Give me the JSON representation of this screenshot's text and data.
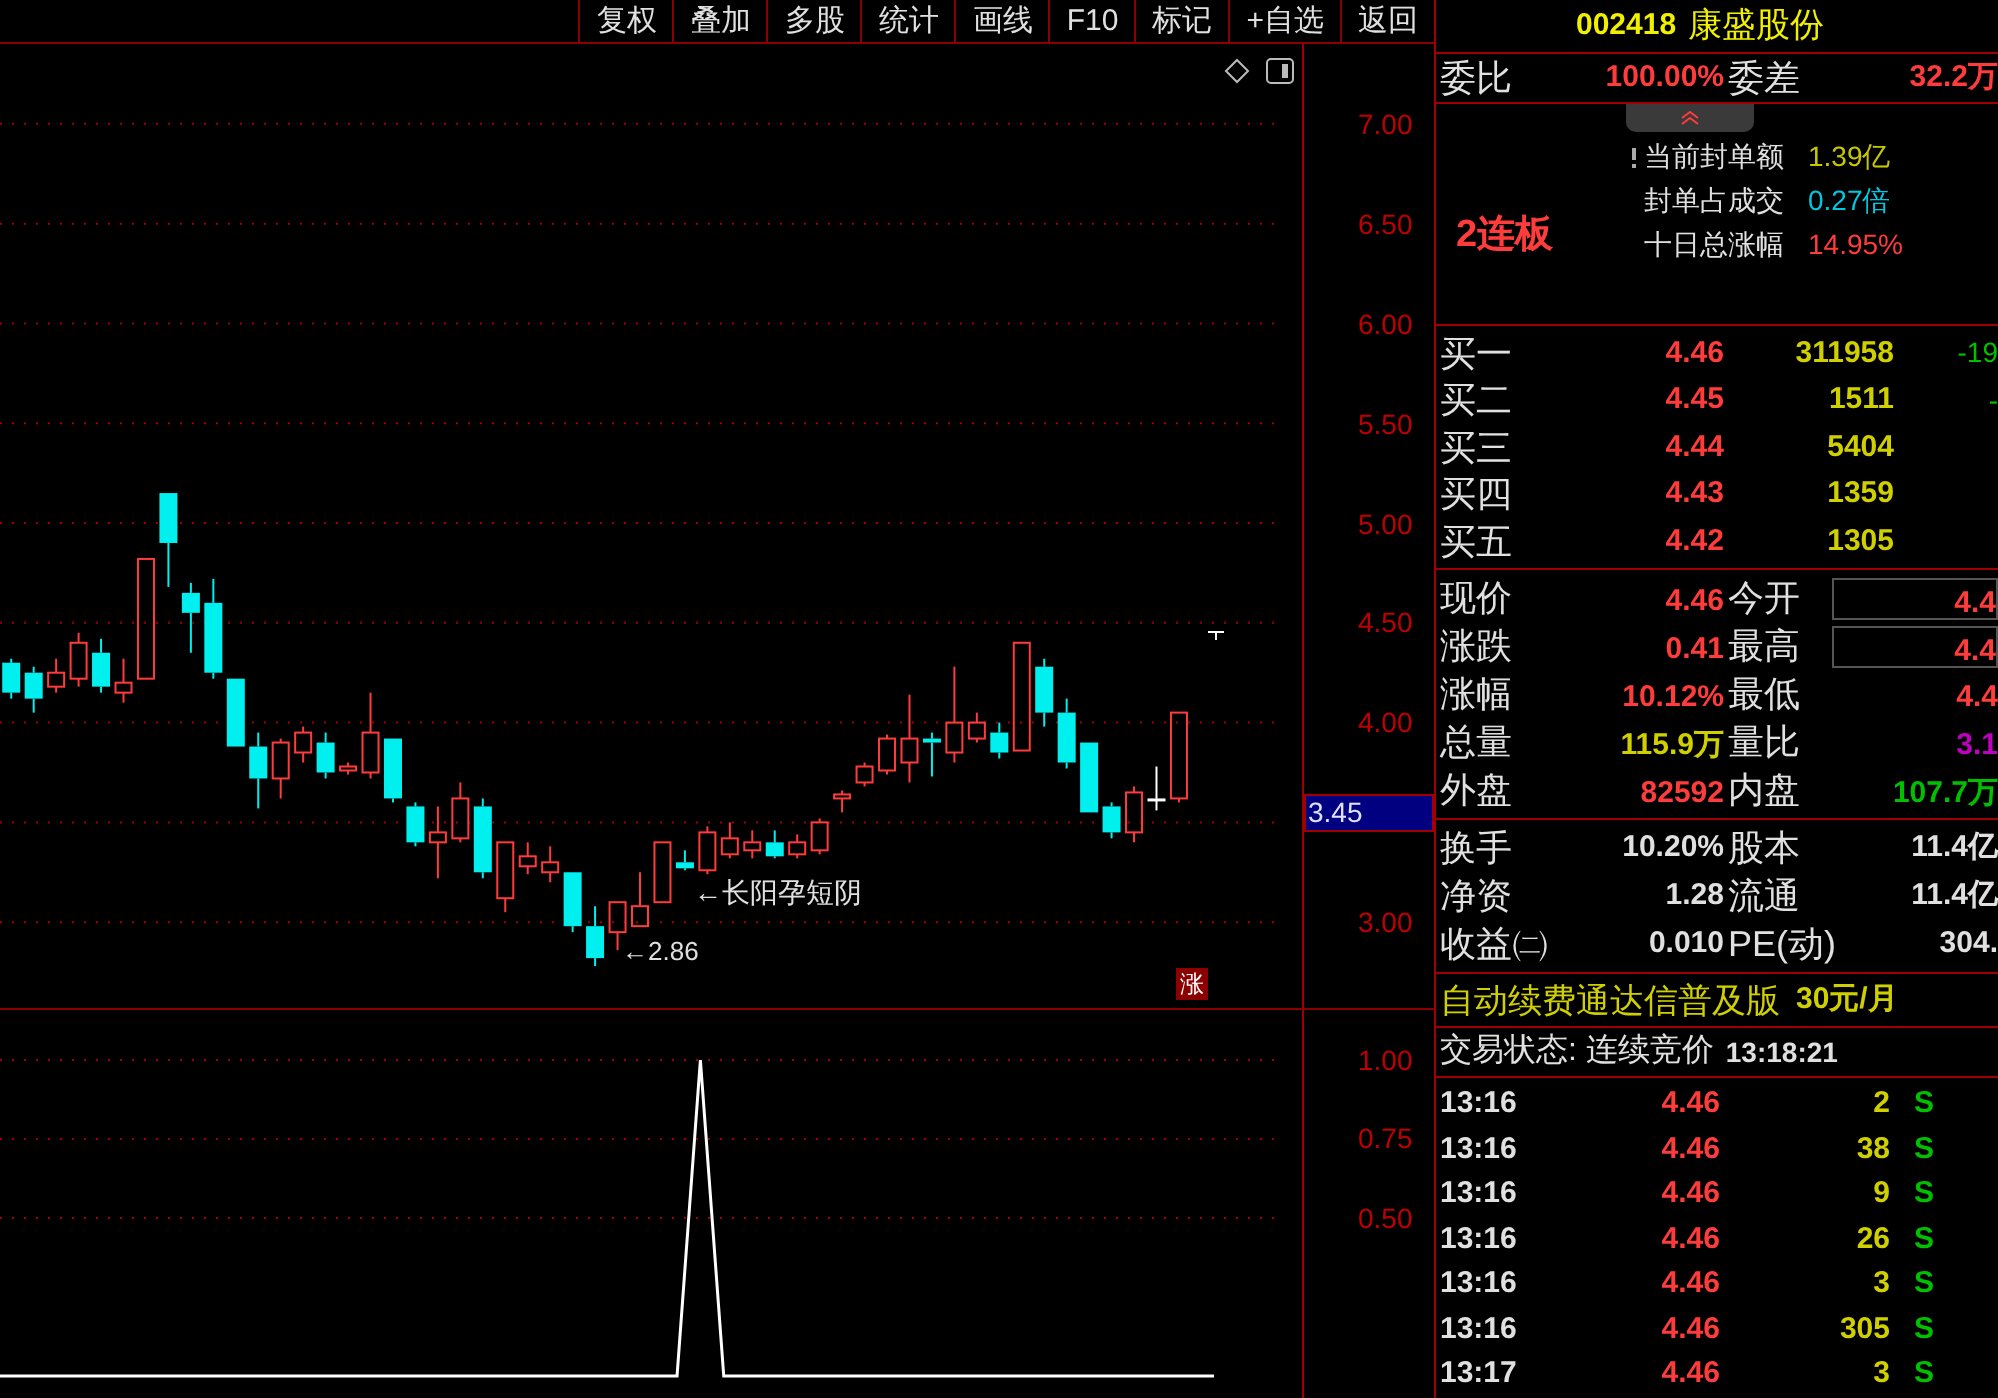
{
  "toolbar": {
    "buttons": [
      {
        "label": "复权"
      },
      {
        "label": "叠加"
      },
      {
        "label": "多股"
      },
      {
        "label": "统计"
      },
      {
        "label": "画线"
      },
      {
        "label": "F10"
      },
      {
        "label": "标记"
      },
      {
        "label": "+自选"
      },
      {
        "label": "返回"
      }
    ]
  },
  "price_chart": {
    "crosshair_price": "3.45",
    "annotations": [
      "←长阳孕短阴",
      "←2.86"
    ],
    "limit_badge": "涨",
    "chart_data": {
      "type": "candlestick",
      "ylim": [
        2.56,
        7.4
      ],
      "grid": true,
      "yticks": [
        {
          "value": 7,
          "label": "7.00"
        },
        {
          "value": 6.5,
          "label": "6.50"
        },
        {
          "value": 6,
          "label": "6.00"
        },
        {
          "value": 5.5,
          "label": "5.50"
        },
        {
          "value": 5,
          "label": "5.00"
        },
        {
          "value": 4.5,
          "label": "4.50"
        },
        {
          "value": 4,
          "label": "4.00"
        },
        {
          "value": 3,
          "label": "3.00"
        }
      ],
      "ohlc": [
        [
          4.3,
          4.32,
          4.12,
          4.15
        ],
        [
          4.25,
          4.28,
          4.05,
          4.12
        ],
        [
          4.18,
          4.32,
          4.15,
          4.25
        ],
        [
          4.22,
          4.45,
          4.18,
          4.4
        ],
        [
          4.35,
          4.42,
          4.15,
          4.18
        ],
        [
          4.15,
          4.32,
          4.1,
          4.2
        ],
        [
          4.22,
          4.82,
          4.22,
          4.82
        ],
        [
          5.15,
          5.15,
          4.68,
          4.9
        ],
        [
          4.65,
          4.7,
          4.35,
          4.55
        ],
        [
          4.6,
          4.72,
          4.22,
          4.25
        ],
        [
          4.22,
          4.22,
          3.88,
          3.88
        ],
        [
          3.88,
          3.95,
          3.57,
          3.72
        ],
        [
          3.72,
          3.92,
          3.62,
          3.9
        ],
        [
          3.85,
          3.98,
          3.8,
          3.95
        ],
        [
          3.9,
          3.95,
          3.72,
          3.75
        ],
        [
          3.76,
          3.8,
          3.74,
          3.78
        ],
        [
          3.75,
          4.15,
          3.72,
          3.95
        ],
        [
          3.92,
          3.92,
          3.6,
          3.62
        ],
        [
          3.58,
          3.6,
          3.38,
          3.4
        ],
        [
          3.4,
          3.58,
          3.22,
          3.45
        ],
        [
          3.42,
          3.7,
          3.4,
          3.62
        ],
        [
          3.58,
          3.62,
          3.22,
          3.25
        ],
        [
          3.12,
          3.4,
          3.05,
          3.4
        ],
        [
          3.28,
          3.4,
          3.24,
          3.33
        ],
        [
          3.25,
          3.38,
          3.2,
          3.3
        ],
        [
          3.25,
          3.25,
          2.95,
          2.98
        ],
        [
          2.98,
          3.08,
          2.78,
          2.82
        ],
        [
          2.95,
          3.1,
          2.86,
          3.1
        ],
        [
          2.98,
          3.25,
          2.98,
          3.08
        ],
        [
          3.1,
          3.4,
          3.1,
          3.4
        ],
        [
          3.3,
          3.36,
          3.26,
          3.27
        ],
        [
          3.26,
          3.48,
          3.24,
          3.45
        ],
        [
          3.34,
          3.5,
          3.32,
          3.42
        ],
        [
          3.36,
          3.46,
          3.32,
          3.4
        ],
        [
          3.4,
          3.46,
          3.32,
          3.33
        ],
        [
          3.34,
          3.44,
          3.32,
          3.4
        ],
        [
          3.36,
          3.52,
          3.34,
          3.5
        ],
        [
          3.62,
          3.66,
          3.55,
          3.64
        ],
        [
          3.7,
          3.8,
          3.68,
          3.78
        ],
        [
          3.76,
          3.94,
          3.74,
          3.92
        ],
        [
          3.8,
          4.14,
          3.7,
          3.92
        ],
        [
          3.92,
          3.95,
          3.73,
          3.9
        ],
        [
          3.85,
          4.28,
          3.8,
          4.0
        ],
        [
          3.92,
          4.05,
          3.9,
          4.0
        ],
        [
          3.95,
          4.0,
          3.82,
          3.85
        ],
        [
          3.86,
          4.4,
          3.86,
          4.4
        ],
        [
          4.28,
          4.32,
          3.98,
          4.05
        ],
        [
          4.05,
          4.12,
          3.77,
          3.8
        ],
        [
          3.9,
          3.9,
          3.55,
          3.55
        ],
        [
          3.58,
          3.6,
          3.42,
          3.45
        ],
        [
          3.45,
          3.68,
          3.4,
          3.65
        ],
        [
          3.62,
          3.78,
          3.56,
          3.62
        ],
        [
          3.62,
          4.05,
          3.6,
          4.05
        ],
        null,
        null,
        null,
        null
      ]
    }
  },
  "indicator": {
    "chart_data": {
      "type": "line",
      "ylim": [
        -0.07,
        1
      ],
      "grid": true,
      "yticks": [
        {
          "value": 1,
          "label": "1.00"
        },
        {
          "value": 0.75,
          "label": "0.75"
        },
        {
          "value": 0.5,
          "label": "0.50"
        }
      ],
      "series": [
        {
          "color": "#ffffff",
          "values": [
            0,
            0,
            0,
            0,
            0,
            0,
            0,
            0,
            0,
            0,
            0,
            0,
            0,
            0,
            0,
            0,
            0,
            0,
            0,
            0,
            0,
            0,
            0,
            0,
            0,
            0,
            0,
            0,
            0,
            0,
            1,
            0,
            0,
            0,
            0,
            0,
            0,
            0,
            0,
            0,
            0,
            0,
            0,
            0,
            0,
            0,
            0,
            0,
            0,
            0,
            0,
            0,
            0
          ]
        }
      ]
    }
  },
  "quote": {
    "code": "002418",
    "name": "康盛股份"
  },
  "order_ratio": [
    {
      "label": "委比",
      "value": "100.00%"
    },
    {
      "label": "委差",
      "value": "32.2万"
    }
  ],
  "seal": {
    "streak": "2连板",
    "items": [
      {
        "label": "当前封单额",
        "value": "1.39亿",
        "color": "#c8c800"
      },
      {
        "label": "封单占成交",
        "value": "0.27倍",
        "color": "#00c8e0"
      },
      {
        "label": "十日总涨幅",
        "value": "14.95%",
        "color": "#ff3c3c"
      }
    ]
  },
  "bids": [
    {
      "label": "买一",
      "price": "4.46",
      "volume": "311958",
      "change": "-19"
    },
    {
      "label": "买二",
      "price": "4.45",
      "volume": "1511",
      "change": "-"
    },
    {
      "label": "买三",
      "price": "4.44",
      "volume": "5404"
    },
    {
      "label": "买四",
      "price": "4.43",
      "volume": "1359"
    },
    {
      "label": "买五",
      "price": "4.42",
      "volume": "1305"
    }
  ],
  "stats": [
    {
      "label": "现价",
      "value": "4.46",
      "color": "#ff3c3c",
      "boxed": false
    },
    {
      "label": "今开",
      "value": "4.4",
      "color": "#ff3c3c",
      "boxed": true
    },
    {
      "label": "涨跌",
      "value": "0.41",
      "color": "#ff3c3c",
      "boxed": false
    },
    {
      "label": "最高",
      "value": "4.4",
      "color": "#ff3c3c",
      "boxed": true
    },
    {
      "label": "涨幅",
      "value": "10.12%",
      "color": "#ff3c3c",
      "boxed": false
    },
    {
      "label": "最低",
      "value": "4.4",
      "color": "#ff3c3c",
      "boxed": false
    },
    {
      "label": "总量",
      "value": "115.9万",
      "color": "#d0d000",
      "boxed": false
    },
    {
      "label": "量比",
      "value": "3.1",
      "color": "#c000c0",
      "boxed": false
    },
    {
      "label": "外盘",
      "value": "82592",
      "color": "#ff3c3c",
      "boxed": false
    },
    {
      "label": "内盘",
      "value": "107.7万",
      "color": "#00c000",
      "boxed": false
    }
  ],
  "fundamentals": [
    {
      "label": "换手",
      "value": "10.20%"
    },
    {
      "label": "股本",
      "value": "11.4亿"
    },
    {
      "label": "净资",
      "value": "1.28"
    },
    {
      "label": "流通",
      "value": "11.4亿"
    },
    {
      "label": "收益㈡",
      "value": "0.010"
    },
    {
      "label": "PE(动)",
      "value": "304."
    }
  ],
  "ad": {
    "text": "自动续费通达信普及版",
    "price": "30元/月"
  },
  "trade_status": {
    "text": "交易状态: 连续竞价",
    "time": "13:18:21"
  },
  "ticks": [
    {
      "time": "13:16",
      "price": "4.46",
      "volume": "2",
      "side": "S"
    },
    {
      "time": "13:16",
      "price": "4.46",
      "volume": "38",
      "side": "S"
    },
    {
      "time": "13:16",
      "price": "4.46",
      "volume": "9",
      "side": "S"
    },
    {
      "time": "13:16",
      "price": "4.46",
      "volume": "26",
      "side": "S"
    },
    {
      "time": "13:16",
      "price": "4.46",
      "volume": "3",
      "side": "S"
    },
    {
      "time": "13:16",
      "price": "4.46",
      "volume": "305",
      "side": "S"
    },
    {
      "time": "13:17",
      "price": "4.46",
      "volume": "3",
      "side": "S"
    }
  ]
}
